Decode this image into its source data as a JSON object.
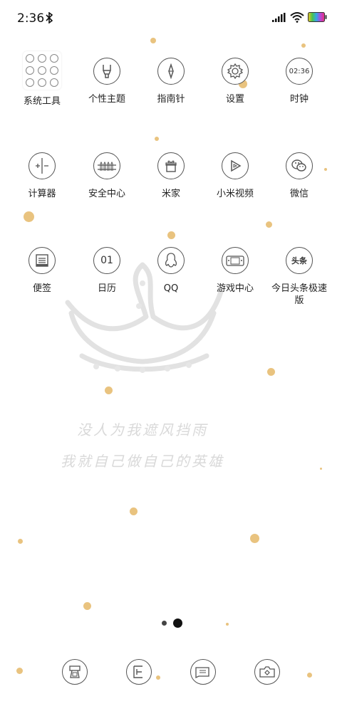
{
  "status": {
    "time": "2:36"
  },
  "apps": [
    {
      "label": "系统工具",
      "icon": "folder-icon"
    },
    {
      "label": "个性主题",
      "icon": "brush-icon"
    },
    {
      "label": "指南针",
      "icon": "compass-icon"
    },
    {
      "label": "设置",
      "icon": "gear-icon"
    },
    {
      "label": "时钟",
      "icon": "clock-icon",
      "icon_text": "02:36"
    },
    {
      "label": "计算器",
      "icon": "calculator-icon"
    },
    {
      "label": "安全中心",
      "icon": "fence-icon"
    },
    {
      "label": "米家",
      "icon": "gift-icon"
    },
    {
      "label": "小米视频",
      "icon": "play-icon"
    },
    {
      "label": "微信",
      "icon": "wechat-icon"
    },
    {
      "label": "便签",
      "icon": "note-icon"
    },
    {
      "label": "日历",
      "icon": "calendar-icon",
      "icon_text": "01"
    },
    {
      "label": "QQ",
      "icon": "penguin-icon"
    },
    {
      "label": "游戏中心",
      "icon": "gamepad-icon"
    },
    {
      "label": "今日头条极速版",
      "icon": "news-icon",
      "icon_text": "头条"
    }
  ],
  "wallpaper": {
    "line1": "没人为我遮风挡雨",
    "line2": "我就自己做自己的英雄"
  },
  "pager": {
    "pages": 2,
    "current": 2
  },
  "dock": [
    {
      "icon": "phone-icon"
    },
    {
      "icon": "contacts-icon"
    },
    {
      "icon": "message-icon"
    },
    {
      "icon": "camera-icon"
    }
  ],
  "colors": {
    "accent_dot": "#e9c37f",
    "icon_stroke": "#555555"
  }
}
